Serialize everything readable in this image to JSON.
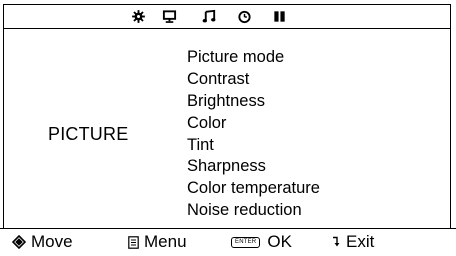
{
  "top_icons": [
    {
      "name": "settings-icon",
      "active": false
    },
    {
      "name": "display-icon",
      "active": false
    },
    {
      "name": "audio-icon",
      "active": false
    },
    {
      "name": "timer-icon",
      "active": false
    },
    {
      "name": "channel-icon",
      "active": false
    }
  ],
  "menu": {
    "title": "PICTURE",
    "items": [
      "Picture mode",
      "Contrast",
      "Brightness",
      "Color",
      "Tint",
      "Sharpness",
      "Color temperature",
      "Noise reduction"
    ]
  },
  "footer": {
    "move": {
      "label": "Move",
      "icon": "dpad-icon"
    },
    "menu": {
      "label": "Menu",
      "icon": "menu-doc-icon"
    },
    "ok": {
      "label": "OK",
      "key": "ENTER",
      "icon": "enter-key-icon"
    },
    "exit": {
      "label": "Exit",
      "icon": "return-arrow-icon"
    }
  }
}
